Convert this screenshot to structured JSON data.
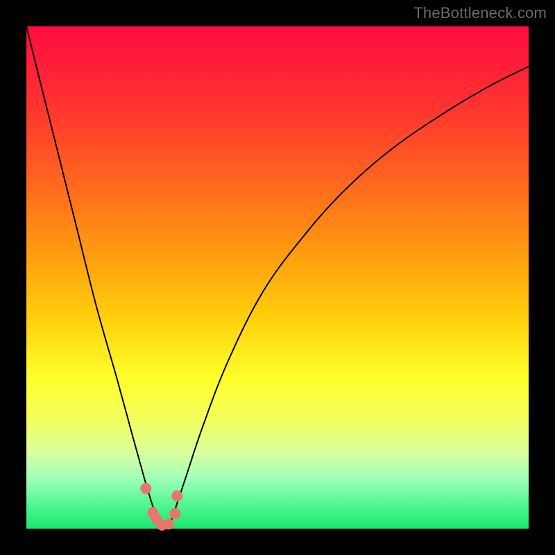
{
  "watermark": "TheBottleneck.com",
  "colors": {
    "page_bg": "#000000",
    "curve": "#000000",
    "marker_fill": "#e8766f",
    "marker_stroke": "#cf5a53"
  },
  "chart_data": {
    "type": "line",
    "title": "",
    "xlabel": "",
    "ylabel": "",
    "xlim": [
      0,
      100
    ],
    "ylim": [
      0,
      100
    ],
    "grid": false,
    "legend": false,
    "note": "Axes are unlabeled; values estimated from curve shape as percentage of plot area (0–100). Curve resembles |component balance| style bottleneck chart with minimum near x≈27.",
    "series": [
      {
        "name": "bottleneck-curve",
        "x": [
          0,
          5,
          10,
          14,
          18,
          21,
          23.5,
          25,
          26,
          27,
          28,
          29,
          30,
          32,
          35,
          40,
          47,
          55,
          63,
          72,
          82,
          92,
          100
        ],
        "values": [
          100,
          80,
          60,
          44,
          30,
          19,
          10,
          5,
          2,
          0.5,
          0.5,
          2,
          5,
          11,
          20,
          33,
          47,
          58,
          67,
          75,
          82,
          88,
          92
        ]
      }
    ],
    "markers": {
      "note": "salmon dots clustered near the minimum",
      "x": [
        23.8,
        25.2,
        25.8,
        27.0,
        28.3,
        29.6,
        30.0
      ],
      "values": [
        8.0,
        3.2,
        2.0,
        0.7,
        0.9,
        3.0,
        6.5
      ]
    }
  }
}
